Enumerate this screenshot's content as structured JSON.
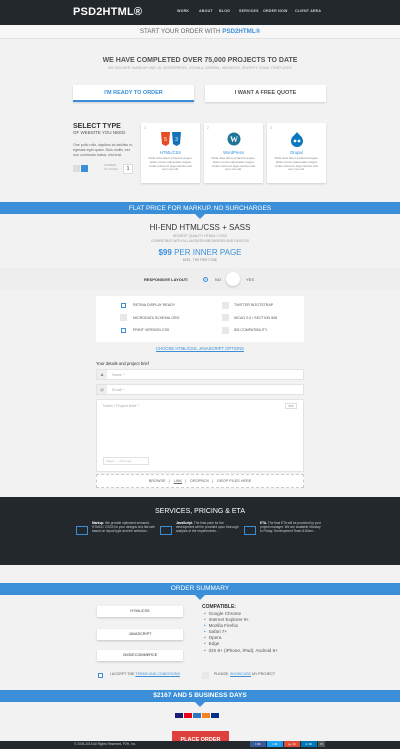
{
  "header": {
    "logo": "PSD2HTML®",
    "nav": [
      "WORK",
      "ABOUT",
      "BLOG",
      "SERVICES",
      "ORDER NOW",
      "CLIENT AREA"
    ]
  },
  "start": {
    "prefix": "START YOUR ORDER WITH",
    "brand": "PSD2HTML®"
  },
  "hero": {
    "title": "WE HAVE COMPLETED OVER 75,000 PROJECTS TO DATE",
    "subtitle": "WE DELIVER: MARKUP AND JS, WORDPRESS, JOOMLA, DRUPAL, MAGENTO, SHOPIFY, EMAIL TEMPLATES",
    "btn_ready": "I'M READY TO ORDER",
    "btn_quote": "I WANT A FREE QUOTE"
  },
  "select_type": {
    "title": "SELECT TYPE",
    "subtitle": "OF WEBSITE YOU NEED",
    "desc": "One pollo rollo, dapibus ac facilisis in, egestas eget quam. Duis mollis, est non commodo luctus, nisi erat.",
    "count": "1",
    "pager_label": "NUMBER OF PAGES",
    "cards": [
      {
        "num": "1",
        "name": "HTML/CSS",
        "desc": "Nulla vitae libero pharetra augue. Etiam porta malesuada magna mollis euismod. Eget lacinia odio sem nec elit."
      },
      {
        "num": "2",
        "name": "WordPress",
        "desc": "Nulla vitae libero pharetra augue. Etiam porta malesuada magna mollis euismod. Eget lacinia odio sem nec elit."
      },
      {
        "num": "3",
        "name": "Drupal",
        "desc": "Nulla vitae libero pharetra augue. Etiam porta malesuada magna mollis euismod. Eget lacinia odio sem nec elit."
      }
    ]
  },
  "flat_price": "FLAT PRICE FOR MARKUP. NO SURCHARGES",
  "product": {
    "title": "HI-END HTML/CSS + SASS",
    "line1": "HIGHEST QUALITY HTML5 / CSS3",
    "line2": "COMPATIBLE WITH ALL MODERN BROWSERS AND DEVICES",
    "price_amount": "$99",
    "price_unit": "PER INNER PAGE",
    "first": "$199 - THE FIRST ONE"
  },
  "responsive": {
    "label": "RESPONSIVE LAYOUT:",
    "no": "NO",
    "yes": "YES"
  },
  "options": [
    {
      "label": "RETINA DISPLAY READY",
      "checked": false,
      "style": "blue"
    },
    {
      "label": "TWITTER BOOTSTRAP",
      "checked": false,
      "style": "grey"
    },
    {
      "label": "MICRODATA SCHEMA.ORG",
      "checked": false,
      "style": "grey"
    },
    {
      "label": "WCAG 2.0 / SECTION 508",
      "checked": false,
      "style": "grey"
    },
    {
      "label": "PRINT VERSION CSS",
      "checked": false,
      "style": "blue"
    },
    {
      "label": "IE8 COMPATIBILITY",
      "checked": false,
      "style": "grey"
    }
  ],
  "choose_link": "CHOOSE HTML/CSS, JAVASCRIPT OPTIONS",
  "brief": {
    "title": "Your details and project brief",
    "name_ph": "Name *",
    "email_ph": "Email *",
    "notes_ph": "Notes / Project brief *",
    "counter": "500",
    "pages_ph": "Pages — what pag",
    "upload": [
      "BROWSE",
      "LINK",
      "DROPBOX",
      "DROP FILES HERE"
    ]
  },
  "services": {
    "title": "SERVICES, PRICING & ETA",
    "items": [
      {
        "key": "Markup.",
        "text": "We provide optimized semantic HTML5 / CSS3 for your designs at a flat rate based on layout type and the selection..."
      },
      {
        "key": "JavaScript.",
        "text": "The final price for the development will be provided upon thorough analysis of the requirements..."
      },
      {
        "key": "ETA.",
        "text": "The final ETA will be provided by your project manager. We are available Monday to Friday. Development Team 8:00am..."
      }
    ]
  },
  "order_summary": {
    "title": "ORDER SUMMARY",
    "items": [
      "HTML/CSS",
      "JAVASCRIPT",
      "CMS/ECOMMERCE"
    ],
    "compat_title": "COMPATIBLE:",
    "compat": [
      "Google Chrome",
      "Internet Explorer 8+",
      "Mozilla Firefox",
      "Safari 7+",
      "Opera",
      "Edge",
      "iOS 8+ (iPhone, iPad), Android 5+"
    ],
    "terms_pre": "I ACCEPT THE",
    "terms_link": "TERMS AND CONDITIONS",
    "showcase_pre": "PLEASE,",
    "showcase_link": "SHOWCASE",
    "showcase_post": "MY PROJECT"
  },
  "total": "$2167 AND 5 BUSINESS DAYS",
  "place_order": "PLACE ORDER",
  "footer": {
    "copy": "© 2005-2015 All Rights Reserved. P2H, Inc.",
    "social": [
      "f 2K",
      "t 4K",
      "g+ 1K",
      "in 3K",
      "✉"
    ]
  },
  "colors": {
    "accent": "#3a8fd8",
    "dark": "#23282d",
    "order": "#e0403b"
  }
}
